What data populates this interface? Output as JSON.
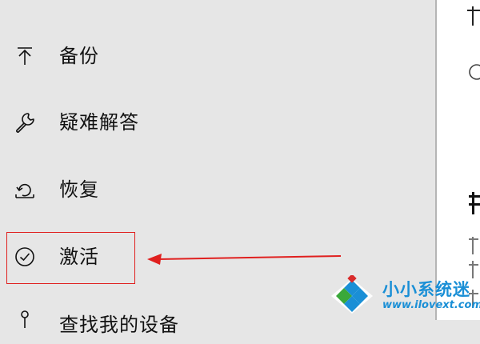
{
  "sidebar": {
    "items": [
      {
        "label": "备份",
        "icon": "backup-arrow-up-icon"
      },
      {
        "label": "疑难解答",
        "icon": "wrench-icon"
      },
      {
        "label": "恢复",
        "icon": "recovery-icon"
      },
      {
        "label": "激活",
        "icon": "check-circle-icon"
      },
      {
        "label": "查找我的设备",
        "icon": "location-pin-icon"
      }
    ]
  },
  "annotation": {
    "box_color": "#e0201f",
    "arrow_color": "#e0201f"
  },
  "watermark": {
    "title": "小小系统迷",
    "url": "www.ilovext.com"
  },
  "colors": {
    "sidebar_bg": "#e6e6e6",
    "content_bg": "#ffffff",
    "watermark_blue": "#1a8fd6",
    "watermark_green": "#3aa83a"
  }
}
